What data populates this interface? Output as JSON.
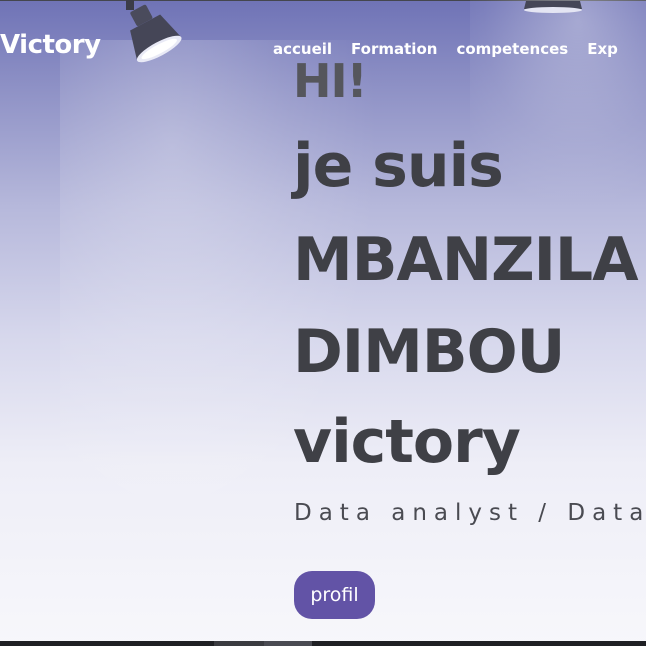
{
  "header": {
    "brand": "Victory",
    "nav": [
      "accueil",
      "Formation",
      "competences",
      "Exp"
    ]
  },
  "hero": {
    "greeting": "HI!",
    "line1": "je suis",
    "line2": "MBANZILA",
    "line3": "DIMBOU",
    "line4": "victory",
    "subtitle": "Data analyst / Data i",
    "button_label": "profil"
  },
  "colors": {
    "accent": "#6253a6",
    "heading": "#3f4046",
    "background_top": "#6f73b6",
    "background_bottom": "#f7f7fb"
  },
  "icons": {
    "lamp_left": "spotlight-lamp-icon",
    "lamp_right": "spotlight-lamp-icon"
  }
}
